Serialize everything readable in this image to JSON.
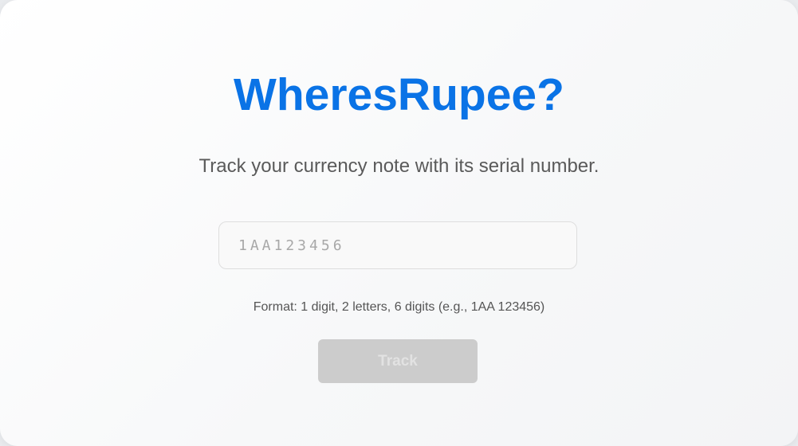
{
  "app": {
    "title": "WheresRupee?",
    "subtitle": "Track your currency note with its serial number."
  },
  "serial_input": {
    "value": "",
    "placeholder": "1AA123456"
  },
  "format_hint": "Format: 1 digit, 2 letters, 6 digits (e.g., 1AA 123456)",
  "track_button": {
    "label": "Track",
    "state": "disabled"
  },
  "colors": {
    "title": "#0a73e6",
    "subtitle": "#5a5a5a",
    "button_disabled_bg": "#cccccc",
    "button_disabled_text": "#e2e2e2"
  }
}
